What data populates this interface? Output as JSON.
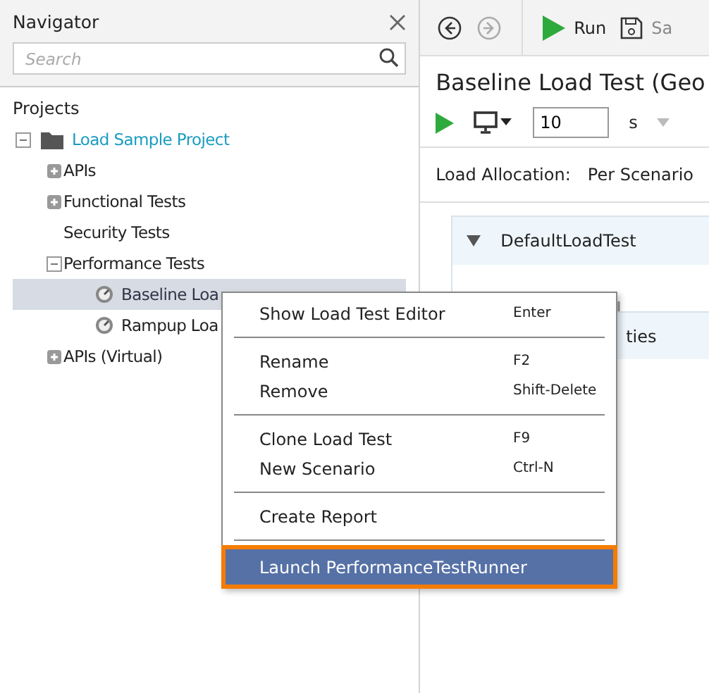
{
  "navigator": {
    "title": "Navigator",
    "search": {
      "placeholder": "Search"
    },
    "tree_heading": "Projects",
    "tree": [
      {
        "label": "Load Sample Project",
        "kind": "project",
        "expanded": true,
        "children": [
          {
            "label": "APIs",
            "kind": "folder",
            "expanded": false,
            "selected": false
          },
          {
            "label": "Functional Tests",
            "kind": "folder",
            "expanded": false,
            "selected": false
          },
          {
            "label": "Security Tests",
            "kind": "leaf",
            "selected": false
          },
          {
            "label": "Performance Tests",
            "kind": "folder",
            "expanded": true,
            "selected": false,
            "children": [
              {
                "label": "Baseline Loa",
                "kind": "test",
                "selected": true
              },
              {
                "label": "Rampup Loa",
                "kind": "test",
                "selected": false
              }
            ]
          },
          {
            "label": "APIs (Virtual)",
            "kind": "folder",
            "expanded": false,
            "selected": false
          }
        ]
      }
    ]
  },
  "toolbar": {
    "run": "Run",
    "save": "Sa"
  },
  "editor": {
    "title": "Baseline Load Test (Geo",
    "duration": "10",
    "unit": "s",
    "allocation_label": "Load Allocation:",
    "allocation_value": "Per Scenario",
    "scenario": "DefaultLoadTest",
    "section_tail": "ties"
  },
  "context_menu": [
    {
      "kind": "item",
      "label": "Show Load Test Editor",
      "shortcut": "Enter",
      "selected": false
    },
    {
      "kind": "separator"
    },
    {
      "kind": "item",
      "label": "Rename",
      "shortcut": "F2",
      "selected": false
    },
    {
      "kind": "item",
      "label": "Remove",
      "shortcut": "Shift-Delete",
      "selected": false
    },
    {
      "kind": "separator"
    },
    {
      "kind": "item",
      "label": "Clone Load Test",
      "shortcut": "F9",
      "selected": false
    },
    {
      "kind": "item",
      "label": "New Scenario",
      "shortcut": "Ctrl-N",
      "selected": false
    },
    {
      "kind": "separator"
    },
    {
      "kind": "item",
      "label": "Create Report",
      "selected": false
    },
    {
      "kind": "separator"
    },
    {
      "kind": "item",
      "label": "Launch PerformanceTestRunner",
      "selected": true
    }
  ]
}
